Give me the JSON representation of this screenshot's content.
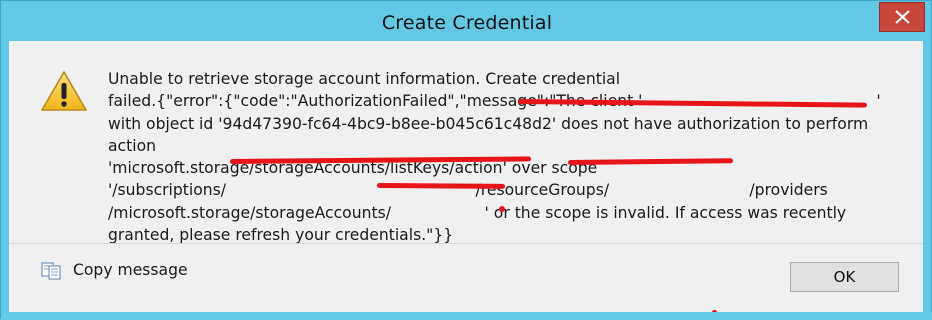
{
  "window": {
    "title": "Create Credential",
    "colors": {
      "frame": "#63c8e6",
      "close_button": "#c8453c",
      "dialog_background": "#f0f0f0",
      "redaction": "#e8141b"
    }
  },
  "icons": {
    "close": "close-icon",
    "warning": "warning-icon",
    "copy": "copy-icon"
  },
  "message": {
    "text": "Unable to retrieve storage account information. Create credential\nfailed.{\"error\":{\"code\":\"AuthorizationFailed\",\"message\":\"The client '               '\nwith object id '94d47390-fc64-4bc9-b8ee-b045c61c48d2' does not have authorization to perform action\n'microsoft.storage/storageAccounts/listKeys/action' over scope\n'/subscriptions/                /resourceGroups/         /providers\n/microsoft.storage/storageAccounts/      ' or the scope is invalid. If access was recently\ngranted, please refresh your credentials.\"}}"
  },
  "actions": {
    "copy_message_label": "Copy message",
    "ok_label": "OK"
  }
}
